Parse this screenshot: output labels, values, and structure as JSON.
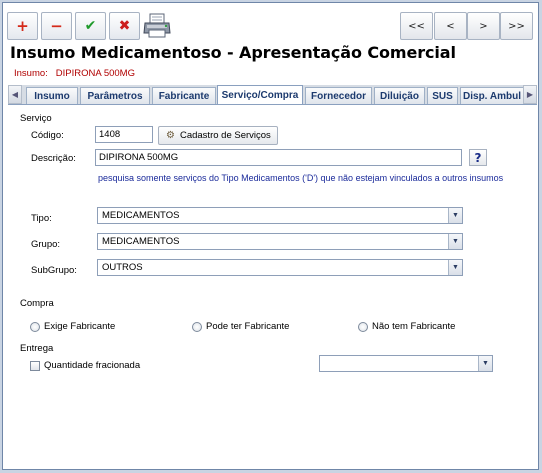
{
  "toolbar": {
    "add": "+",
    "delete": "−",
    "confirm": "✔",
    "cancel": "✖",
    "nav": [
      "<<",
      "<",
      ">",
      ">>"
    ]
  },
  "header": {
    "title": "Insumo Medicamentoso - Apresentação Comercial",
    "insumo_label": "Insumo:",
    "insumo_value": "DIPIRONA 500MG"
  },
  "tabs": [
    "Insumo",
    "Parâmetros",
    "Fabricante",
    "Serviço/Compra",
    "Fornecedor",
    "Diluição",
    "SUS",
    "Disp. Ambul"
  ],
  "active_tab": "Serviço/Compra",
  "servico": {
    "section_label": "Serviço",
    "codigo_label": "Código:",
    "codigo_value": "1408",
    "cadastro_button": "Cadastro de Serviços",
    "descricao_label": "Descrição:",
    "descricao_value": "DIPIRONA 500MG",
    "help_label": "?",
    "hint": "pesquisa somente serviços do Tipo Medicamentos ('D') que não estejam vinculados a outros insumos",
    "tipo_label": "Tipo:",
    "tipo_value": "MEDICAMENTOS",
    "grupo_label": "Grupo:",
    "grupo_value": "MEDICAMENTOS",
    "subgrupo_label": "SubGrupo:",
    "subgrupo_value": "OUTROS"
  },
  "compra": {
    "section_label": "Compra",
    "options": [
      "Exige Fabricante",
      "Pode ter Fabricante",
      "Não tem Fabricante"
    ]
  },
  "entrega": {
    "section_label": "Entrega",
    "checkbox_label": "Quantidade fracionada",
    "select_value": ""
  },
  "colors": {
    "accent": "#1c3a6e",
    "subtitle": "#b00000",
    "hint": "#1a2a9a"
  }
}
